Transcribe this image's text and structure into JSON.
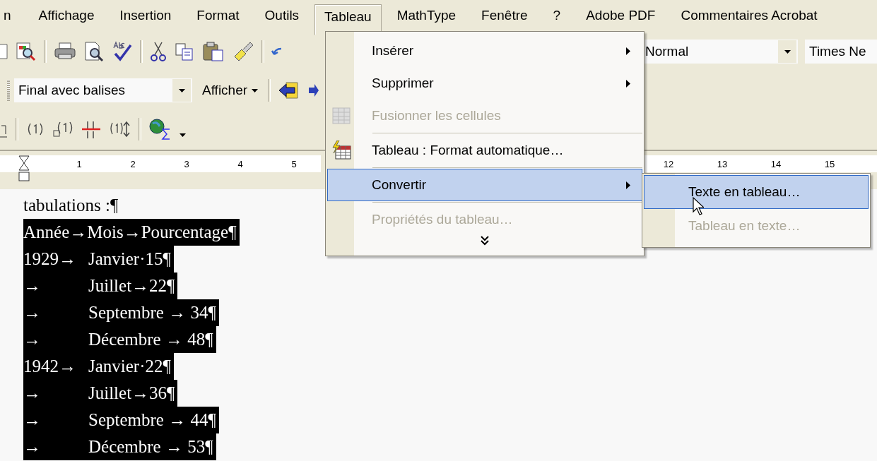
{
  "menubar": [
    {
      "label": "n",
      "selected": false
    },
    {
      "label": "Affichage",
      "selected": false
    },
    {
      "label": "Insertion",
      "selected": false
    },
    {
      "label": "Format",
      "selected": false
    },
    {
      "label": "Outils",
      "selected": false
    },
    {
      "label": "Tableau",
      "selected": true
    },
    {
      "label": "MathType",
      "selected": false
    },
    {
      "label": "Fenêtre",
      "selected": false
    },
    {
      "label": "?",
      "selected": false
    },
    {
      "label": "Adobe PDF",
      "selected": false
    },
    {
      "label": "Commentaires Acrobat",
      "selected": false
    }
  ],
  "toolbar": {
    "style_field": {
      "value": "Normal"
    },
    "font_field": {
      "value": "Times Ne"
    },
    "markup_field": {
      "value": "Final avec balises"
    },
    "show_button": {
      "label": "Afficher"
    }
  },
  "ruler": {
    "left_numbers": [
      "1",
      "2",
      "3",
      "4",
      "5"
    ],
    "right_numbers": [
      "12",
      "13",
      "14",
      "15"
    ]
  },
  "document": {
    "lines": [
      {
        "selected": false,
        "segments": [
          "tabulations :¶"
        ]
      },
      {
        "selected": true,
        "segments": [
          "Année→Mois→Pourcentage¶"
        ]
      },
      {
        "selected": true,
        "segments": [
          "1929→",
          "Janvier·15¶"
        ]
      },
      {
        "selected": true,
        "segments": [
          "→",
          "Juillet→22¶"
        ]
      },
      {
        "selected": true,
        "segments": [
          "→",
          "Septembre → 34¶"
        ]
      },
      {
        "selected": true,
        "segments": [
          "→",
          "Décembre → 48¶"
        ]
      },
      {
        "selected": true,
        "segments": [
          "1942→",
          "Janvier·22¶"
        ]
      },
      {
        "selected": true,
        "segments": [
          "→",
          "Juillet→36¶"
        ]
      },
      {
        "selected": true,
        "segments": [
          "→",
          "Septembre → 44¶"
        ]
      },
      {
        "selected": true,
        "segments": [
          "→",
          "Décembre → 53¶"
        ]
      }
    ]
  },
  "table_menu": {
    "items": [
      {
        "kind": "submenu",
        "label": "Insérer",
        "selected": false,
        "disabled": false
      },
      {
        "kind": "submenu",
        "label": "Supprimer",
        "selected": false,
        "disabled": false
      },
      {
        "kind": "command",
        "label": "Fusionner les cellules",
        "selected": false,
        "disabled": true
      },
      {
        "kind": "separator"
      },
      {
        "kind": "command",
        "label": "Tableau : Format automatique…",
        "selected": false,
        "disabled": false
      },
      {
        "kind": "separator"
      },
      {
        "kind": "submenu",
        "label": "Convertir",
        "selected": true,
        "disabled": false
      },
      {
        "kind": "separator"
      },
      {
        "kind": "command",
        "label": "Propriétés du tableau…",
        "selected": false,
        "disabled": true
      },
      {
        "kind": "expand"
      }
    ]
  },
  "convert_submenu": {
    "items": [
      {
        "label": "Texte en tableau…",
        "selected": true,
        "disabled": false
      },
      {
        "label": "Tableau en texte…",
        "selected": false,
        "disabled": true
      }
    ]
  }
}
